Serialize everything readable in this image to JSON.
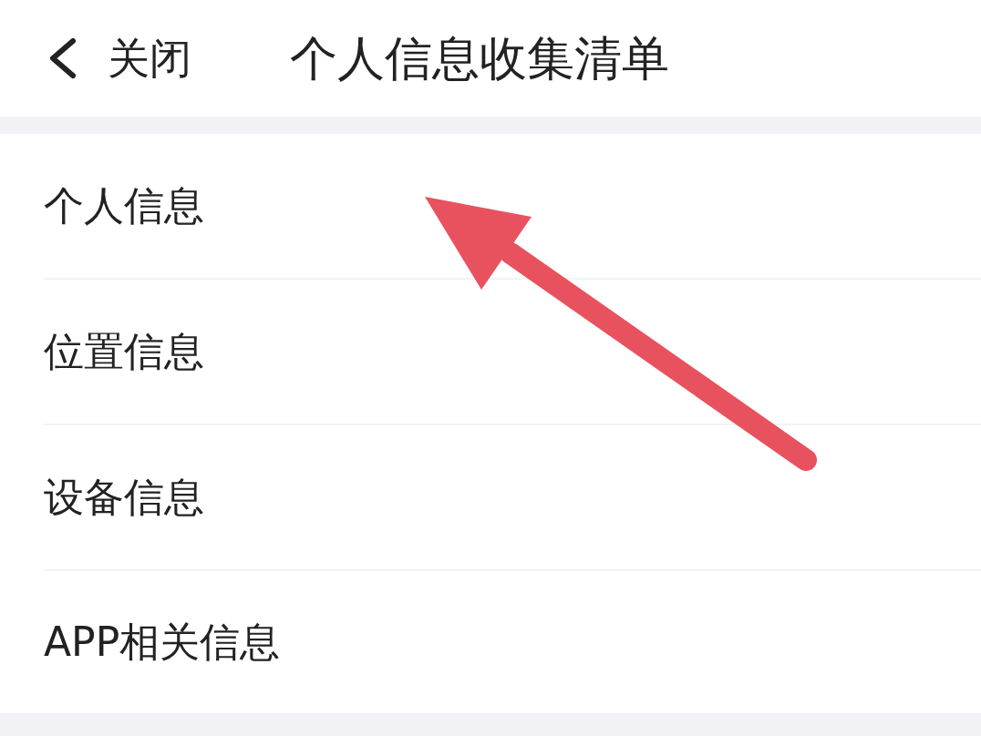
{
  "header": {
    "back_button": {
      "label": "关闭"
    },
    "title": "个人信息收集清单"
  },
  "list": {
    "items": [
      {
        "label": "个人信息"
      },
      {
        "label": "位置信息"
      },
      {
        "label": "设备信息"
      },
      {
        "label": "APP相关信息"
      }
    ]
  }
}
